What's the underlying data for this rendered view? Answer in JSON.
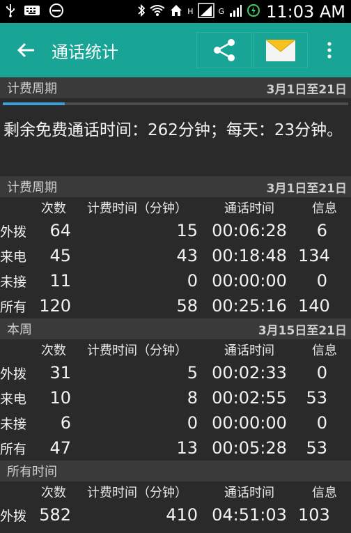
{
  "status_bar": {
    "time": "11:03 AM",
    "network_h": "H",
    "network_g": "G"
  },
  "app_bar": {
    "title": "通话统计",
    "back_icon": "arrow-left-icon",
    "share_icon": "share-icon",
    "mail_icon": "mail-icon",
    "menu_icon": "overflow-menu-icon"
  },
  "summary": {
    "header_label": "计费周期",
    "header_range": "3月1日至21日",
    "progress_percent": 18,
    "text": "剩余免费通话时间：262分钟；每天：23分钟。"
  },
  "columns": {
    "count": "次数",
    "billed": "计费时间（分钟）",
    "duration": "通话时间",
    "messages": "信息"
  },
  "sections": [
    {
      "label": "计费周期",
      "range": "3月1日至21日",
      "rows": [
        {
          "label": "外拨",
          "count": "64",
          "billed": "15",
          "duration": "00:06:28",
          "messages": "6"
        },
        {
          "label": "来电",
          "count": "45",
          "billed": "43",
          "duration": "00:18:48",
          "messages": "134"
        },
        {
          "label": "未接",
          "count": "11",
          "billed": "0",
          "duration": "00:00:00",
          "messages": "0"
        },
        {
          "label": "所有",
          "count": "120",
          "billed": "58",
          "duration": "00:25:16",
          "messages": "140"
        }
      ]
    },
    {
      "label": "本周",
      "range": "3月15日至21日",
      "rows": [
        {
          "label": "外拨",
          "count": "31",
          "billed": "5",
          "duration": "00:02:33",
          "messages": "0"
        },
        {
          "label": "来电",
          "count": "10",
          "billed": "8",
          "duration": "00:02:55",
          "messages": "53"
        },
        {
          "label": "未接",
          "count": "6",
          "billed": "0",
          "duration": "00:00:00",
          "messages": "0"
        },
        {
          "label": "所有",
          "count": "47",
          "billed": "13",
          "duration": "00:05:28",
          "messages": "53"
        }
      ]
    },
    {
      "label": "所有时间",
      "range": "",
      "rows": [
        {
          "label": "外拨",
          "count": "582",
          "billed": "410",
          "duration": "04:51:03",
          "messages": "103"
        }
      ]
    }
  ]
}
